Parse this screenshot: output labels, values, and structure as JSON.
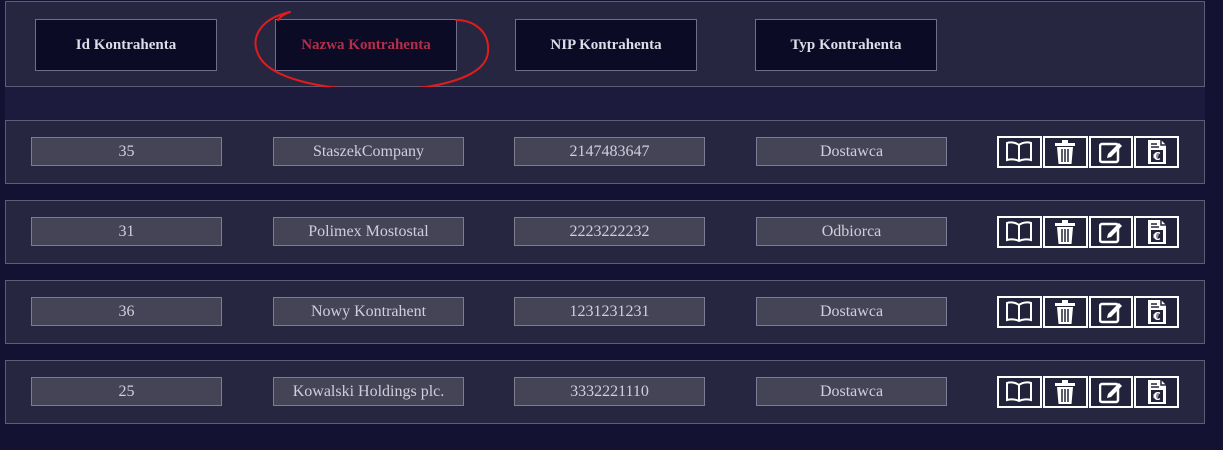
{
  "header": {
    "columns": [
      {
        "label": "Id Kontrahenta"
      },
      {
        "label": "Nazwa Kontrahenta"
      },
      {
        "label": "NIP Kontrahenta"
      },
      {
        "label": "Typ Kontrahenta"
      }
    ],
    "active_column": "Nazwa Kontrahenta",
    "highlight_color": "#e01c1c"
  },
  "rows": [
    {
      "id": "35",
      "name": "StaszekCompany",
      "nip": "2147483647",
      "type": "Dostawca"
    },
    {
      "id": "31",
      "name": "Polimex Mostostal",
      "nip": "2223222232",
      "type": "Odbiorca"
    },
    {
      "id": "36",
      "name": "Nowy Kontrahent",
      "nip": "1231231231",
      "type": "Dostawca"
    },
    {
      "id": "25",
      "name": "Kowalski Holdings plc.",
      "nip": "3332221110",
      "type": "Dostawca"
    }
  ],
  "row_actions": [
    {
      "icon": "book-icon",
      "action": "view"
    },
    {
      "icon": "trash-icon",
      "action": "delete"
    },
    {
      "icon": "edit-icon",
      "action": "edit"
    },
    {
      "icon": "euro-document-icon",
      "action": "invoice"
    }
  ],
  "colors": {
    "background": "#131232",
    "panel": "#262640",
    "header_button": "#0b0b26",
    "cell": "#454456",
    "active_text": "#b32e4a"
  }
}
